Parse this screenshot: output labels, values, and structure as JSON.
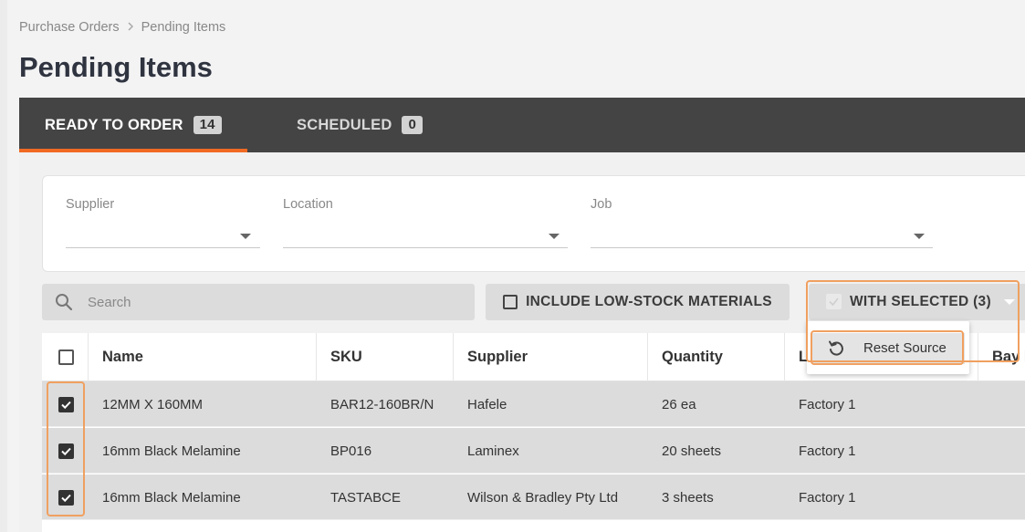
{
  "breadcrumb": {
    "parent": "Purchase Orders",
    "current": "Pending Items"
  },
  "page_title": "Pending Items",
  "tabs": [
    {
      "label": "READY TO ORDER",
      "count": "14",
      "active": true
    },
    {
      "label": "SCHEDULED",
      "count": "0",
      "active": false
    }
  ],
  "filters": {
    "supplier": {
      "label": "Supplier",
      "value": ""
    },
    "location": {
      "label": "Location",
      "value": ""
    },
    "job": {
      "label": "Job",
      "value": ""
    }
  },
  "search": {
    "placeholder": "Search",
    "value": ""
  },
  "toolbar": {
    "include_low_stock_label": "INCLUDE LOW-STOCK MATERIALS",
    "with_selected_label": "WITH SELECTED (3)"
  },
  "dropdown": {
    "items": [
      {
        "label": "Reset Source",
        "icon": "reset-icon"
      }
    ]
  },
  "table": {
    "columns": [
      "Name",
      "SKU",
      "Supplier",
      "Quantity",
      "L",
      "Bay L"
    ],
    "rows": [
      {
        "checked": true,
        "name": "12MM X 160MM",
        "sku": "BAR12-160BR/N",
        "supplier": "Hafele",
        "quantity": "26 ea",
        "location": "Factory 1"
      },
      {
        "checked": true,
        "name": "16mm Black Melamine",
        "sku": "BP016",
        "supplier": "Laminex",
        "quantity": "20 sheets",
        "location": "Factory 1"
      },
      {
        "checked": true,
        "name": "16mm Black Melamine",
        "sku": "TASTABCE",
        "supplier": "Wilson & Bradley Pty Ltd",
        "quantity": "3 sheets",
        "location": "Factory 1"
      }
    ]
  },
  "colors": {
    "accent": "#f06a23",
    "tabbar": "#444444",
    "highlight": "#f0a060"
  }
}
